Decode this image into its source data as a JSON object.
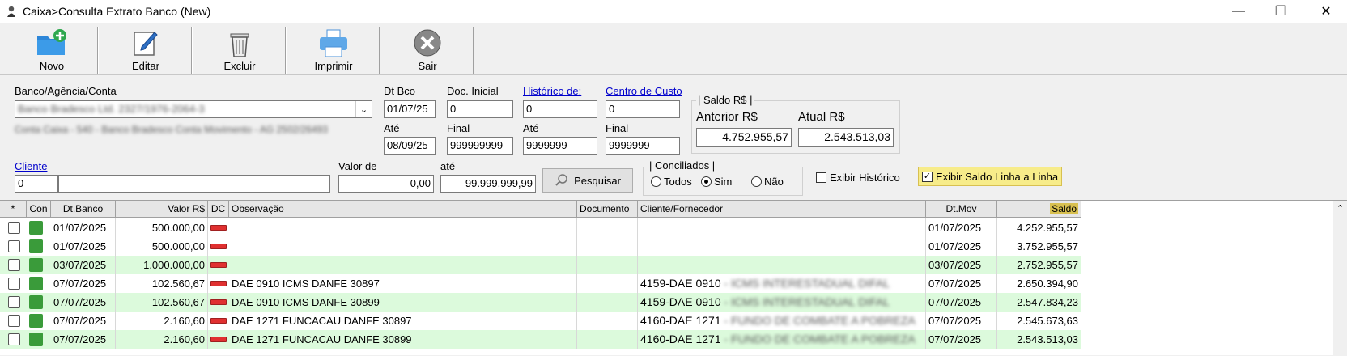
{
  "window": {
    "title": "Caixa>Consulta Extrato Banco (New)",
    "min": "—",
    "max": "❐",
    "close": "✕"
  },
  "toolbar": [
    {
      "label": "Novo",
      "icon": "folder-add-icon"
    },
    {
      "label": "Editar",
      "icon": "edit-icon"
    },
    {
      "label": "Excluir",
      "icon": "trash-icon"
    },
    {
      "label": "Imprimir",
      "icon": "printer-icon"
    },
    {
      "label": "Sair",
      "icon": "close-circle-icon"
    }
  ],
  "filters": {
    "banco_label": "Banco/Agência/Conta",
    "banco_value": "Banco Bradesco Ltd. 2327/1976-2064-3",
    "banco_desc": "Conta Caixa - 540 - Banco Bradesco Conta Movimento - AG 2502/26493",
    "dtbco_label": "Dt Bco",
    "dtbco_value": "01/07/25",
    "ate_label": "Até",
    "ate_value": "08/09/25",
    "docini_label": "Doc. Inicial",
    "docini_value": "0",
    "final_label": "Final",
    "final_value": "999999999",
    "hist_label": "Histórico de:",
    "hist_value": "0",
    "hist_ate_label": "Até",
    "hist_ate_value": "9999999",
    "cc_label": "Centro de Custo",
    "cc_value": "0",
    "cc_final_label": "Final",
    "cc_final_value": "9999999",
    "saldo_group": "| Saldo R$ |",
    "anterior_label": "Anterior R$",
    "anterior_value": "4.752.955,57",
    "atual_label": "Atual R$",
    "atual_value": "2.543.513,03",
    "cliente_label": "Cliente",
    "cliente_code": "0",
    "cliente_name": "",
    "valor_de_label": "Valor de",
    "valor_de_value": "0,00",
    "valor_ate_label": "até",
    "valor_ate_value": "99.999.999,99",
    "pesquisar": "Pesquisar",
    "conciliados_group": "| Conciliados |",
    "radio_todos": "Todos",
    "radio_sim": "Sim",
    "radio_nao": "Não",
    "exibir_historico": "Exibir Histórico",
    "exibir_saldo": "Exibir Saldo Linha a Linha"
  },
  "grid": {
    "headers": [
      "*",
      "Con",
      "Dt.Banco",
      "Valor R$",
      "DC",
      "Observação",
      "Documento",
      "Cliente/Fornecedor",
      "Dt.Mov",
      "Saldo"
    ],
    "rows": [
      {
        "dt": "01/07/2025",
        "valor": "500.000,00",
        "obs": "",
        "doc": "",
        "cli": "",
        "cli_blur": "",
        "dtmov": "01/07/2025",
        "saldo": "4.252.955,57"
      },
      {
        "dt": "01/07/2025",
        "valor": "500.000,00",
        "obs": "",
        "doc": "",
        "cli": "",
        "cli_blur": "",
        "dtmov": "01/07/2025",
        "saldo": "3.752.955,57"
      },
      {
        "dt": "03/07/2025",
        "valor": "1.000.000,00",
        "obs": "",
        "doc": "",
        "cli": "",
        "cli_blur": "",
        "dtmov": "03/07/2025",
        "saldo": "2.752.955,57"
      },
      {
        "dt": "07/07/2025",
        "valor": "102.560,67",
        "obs": "DAE 0910 ICMS DANFE 30897",
        "doc": "",
        "cli": "4159-DAE 0910",
        "cli_blur": " - ICMS INTERESTADUAL DIFAL",
        "dtmov": "07/07/2025",
        "saldo": "2.650.394,90"
      },
      {
        "dt": "07/07/2025",
        "valor": "102.560,67",
        "obs": "DAE 0910 ICMS DANFE 30899",
        "doc": "",
        "cli": "4159-DAE 0910",
        "cli_blur": " - ICMS INTERESTADUAL DIFAL",
        "dtmov": "07/07/2025",
        "saldo": "2.547.834,23"
      },
      {
        "dt": "07/07/2025",
        "valor": "2.160,60",
        "obs": "DAE 1271 FUNCACAU DANFE 30897",
        "doc": "",
        "cli": "4160-DAE 1271",
        "cli_blur": " - FUNDO DE COMBATE A POBREZA",
        "dtmov": "07/07/2025",
        "saldo": "2.545.673,63"
      },
      {
        "dt": "07/07/2025",
        "valor": "2.160,60",
        "obs": "DAE 1271 FUNCACAU DANFE 30899",
        "doc": "",
        "cli": "4160-DAE 1271",
        "cli_blur": " - FUNDO DE COMBATE A POBREZA",
        "dtmov": "07/07/2025",
        "saldo": "2.543.513,03"
      }
    ]
  },
  "colors": {
    "row_alt": "#dcfadc",
    "saldo_header": "#d8c050",
    "highlight_chk": "#f7ec8a",
    "link": "#0000cc"
  }
}
